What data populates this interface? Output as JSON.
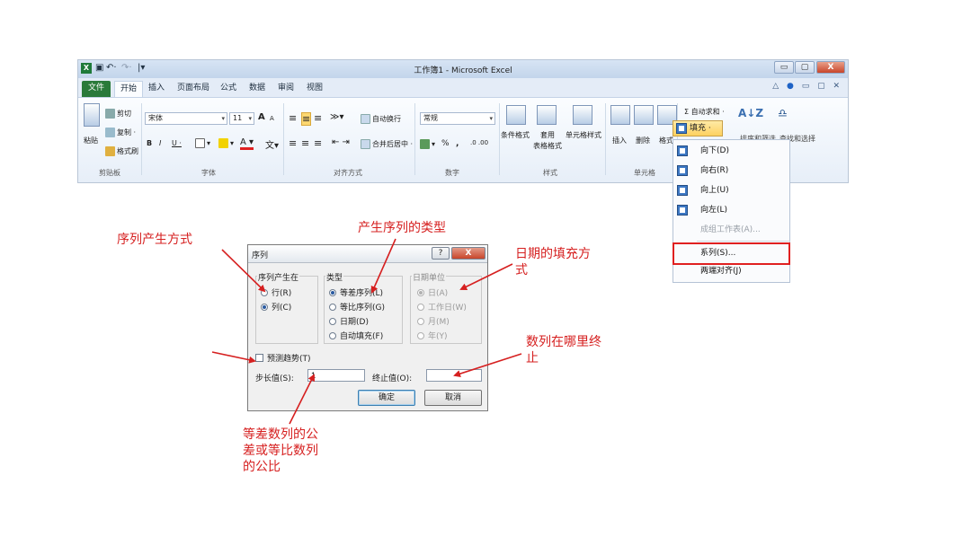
{
  "window": {
    "title": "工作簿1 - Microsoft Excel",
    "app_icon": "X",
    "qat": [
      "save-icon",
      "undo-icon",
      "redo-icon",
      "customize-icon"
    ],
    "controls": [
      "▭",
      "▢",
      "X"
    ]
  },
  "tabs": [
    "文件",
    "开始",
    "插入",
    "页面布局",
    "公式",
    "数据",
    "审阅",
    "视图"
  ],
  "active_tab": "开始",
  "ribbon": {
    "clipboard": {
      "paste": "粘贴",
      "cut": "剪切",
      "copy": "复制 ·",
      "format_painter": "格式刷",
      "label": "剪贴板"
    },
    "font": {
      "name": "宋体",
      "size": "11",
      "grow": "A",
      "shrink": "A",
      "bold": "B",
      "italic": "I",
      "underline": "U ·",
      "label": "字体"
    },
    "alignment": {
      "wrap": "自动换行",
      "merge": "合并后居中 ·",
      "label": "对齐方式"
    },
    "number": {
      "format": "常规",
      "percent": "%",
      "comma": ",",
      "label": "数字"
    },
    "styles": {
      "conditional": "条件格式",
      "table": "套用\n表格格式",
      "cell": "单元格样式",
      "label": "样式"
    },
    "cells": {
      "insert": "插入",
      "delete": "删除",
      "format": "格式",
      "label": "单元格"
    },
    "editing": {
      "autosum": "Σ 自动求和 ·",
      "fill": "填充 ·",
      "sort": "排序和筛选",
      "find": "查找和选择"
    }
  },
  "fill_menu": [
    {
      "label": "向下(D)",
      "enabled": true
    },
    {
      "label": "向右(R)",
      "enabled": true
    },
    {
      "label": "向上(U)",
      "enabled": true
    },
    {
      "label": "向左(L)",
      "enabled": true
    },
    {
      "label": "成组工作表(A)...",
      "enabled": false
    },
    {
      "label": "系列(S)...",
      "enabled": true
    },
    {
      "label": "两端对齐(J)",
      "enabled": true
    }
  ],
  "dialog": {
    "title": "序列",
    "help": "?",
    "close": "X",
    "series_in": {
      "legend": "序列产生在",
      "options": [
        "行(R)",
        "列(C)"
      ],
      "selected": 1
    },
    "type": {
      "legend": "类型",
      "options": [
        "等差序列(L)",
        "等比序列(G)",
        "日期(D)",
        "自动填充(F)"
      ],
      "selected": 0
    },
    "date_unit": {
      "legend": "日期单位",
      "options": [
        "日(A)",
        "工作日(W)",
        "月(M)",
        "年(Y)"
      ],
      "selected": 0
    },
    "trend": "预测趋势(T)",
    "step_label": "步长值(S):",
    "step_value": "1",
    "stop_label": "终止值(O):",
    "stop_value": "",
    "ok": "确定",
    "cancel": "取消"
  },
  "annotations": {
    "series_in": "序列产生方式",
    "type": "产生序列的类型",
    "date_unit": "日期的填充方\n式",
    "stop": "数列在哪里终\n止",
    "step": "等差数列的公\n差或等比数列\n的公比"
  },
  "colors": {
    "annotation": "#d62020",
    "highlight": "#e02020",
    "file_tab": "#2a7a3a"
  }
}
